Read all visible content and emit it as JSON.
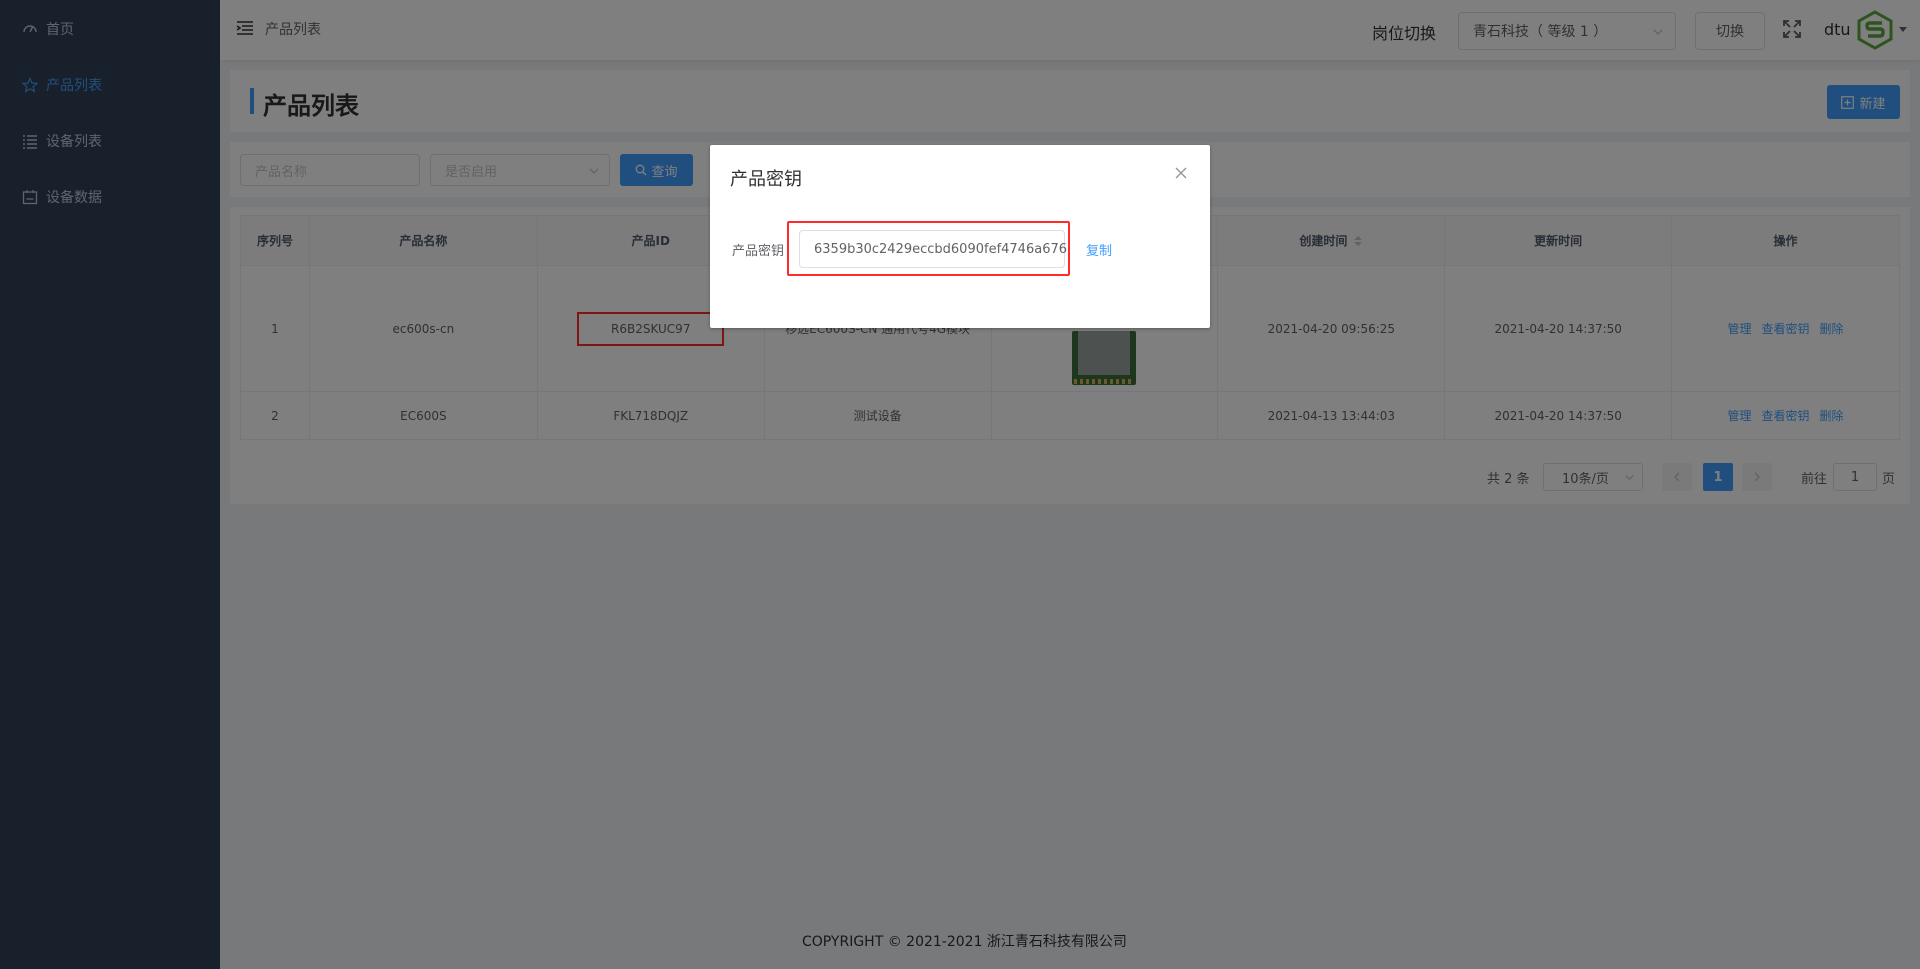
{
  "sidebar": {
    "items": [
      {
        "label": "首页",
        "icon": "dashboard-icon",
        "active": false
      },
      {
        "label": "产品列表",
        "icon": "star-outline-icon",
        "active": true
      },
      {
        "label": "设备列表",
        "icon": "list-icon",
        "active": false
      },
      {
        "label": "设备数据",
        "icon": "calendar-data-icon",
        "active": false
      }
    ]
  },
  "header": {
    "breadcrumb": "产品列表",
    "post_label": "岗位切换",
    "post_select_value": "青石科技（ 等级 1 ）",
    "switch_label": "切换",
    "username": "dtu"
  },
  "page": {
    "title": "产品列表",
    "new_label": "新建"
  },
  "filter": {
    "name_placeholder": "产品名称",
    "enabled_placeholder": "是否启用",
    "query_label": "查询"
  },
  "table": {
    "headers": [
      "序列号",
      "产品名称",
      "产品ID",
      "",
      "",
      "创建时间",
      "更新时间",
      "操作"
    ],
    "rows": [
      {
        "index": "1",
        "name": "ec600s-cn",
        "id": "R6B2SKUC97",
        "desc": "移远EC600S-CN 通用代号4G模块",
        "created": "2021-04-20 09:56:25",
        "updated": "2021-04-20 14:37:50"
      },
      {
        "index": "2",
        "name": "EC600S",
        "id": "FKL718DQJZ",
        "desc": "测试设备",
        "created": "2021-04-13 13:44:03",
        "updated": "2021-04-20 14:37:50"
      }
    ],
    "actions": [
      "管理",
      "查看密钥",
      "删除"
    ]
  },
  "pagination": {
    "total_text": "共 2 条",
    "page_size": "10条/页",
    "current_page": "1",
    "goto_prefix": "前往",
    "goto_value": "1",
    "goto_suffix": "页"
  },
  "footer": {
    "copyright": "COPYRIGHT © 2021-2021 浙江青石科技有限公司"
  },
  "modal": {
    "title": "产品密钥",
    "key_label": "产品密钥",
    "key_value": "6359b30c2429eccbd6090fef4746a676",
    "copy_label": "复制"
  },
  "colors": {
    "sidebar_bg": "#304156",
    "accent": "#409eff",
    "highlight": "#ff2b2b"
  }
}
